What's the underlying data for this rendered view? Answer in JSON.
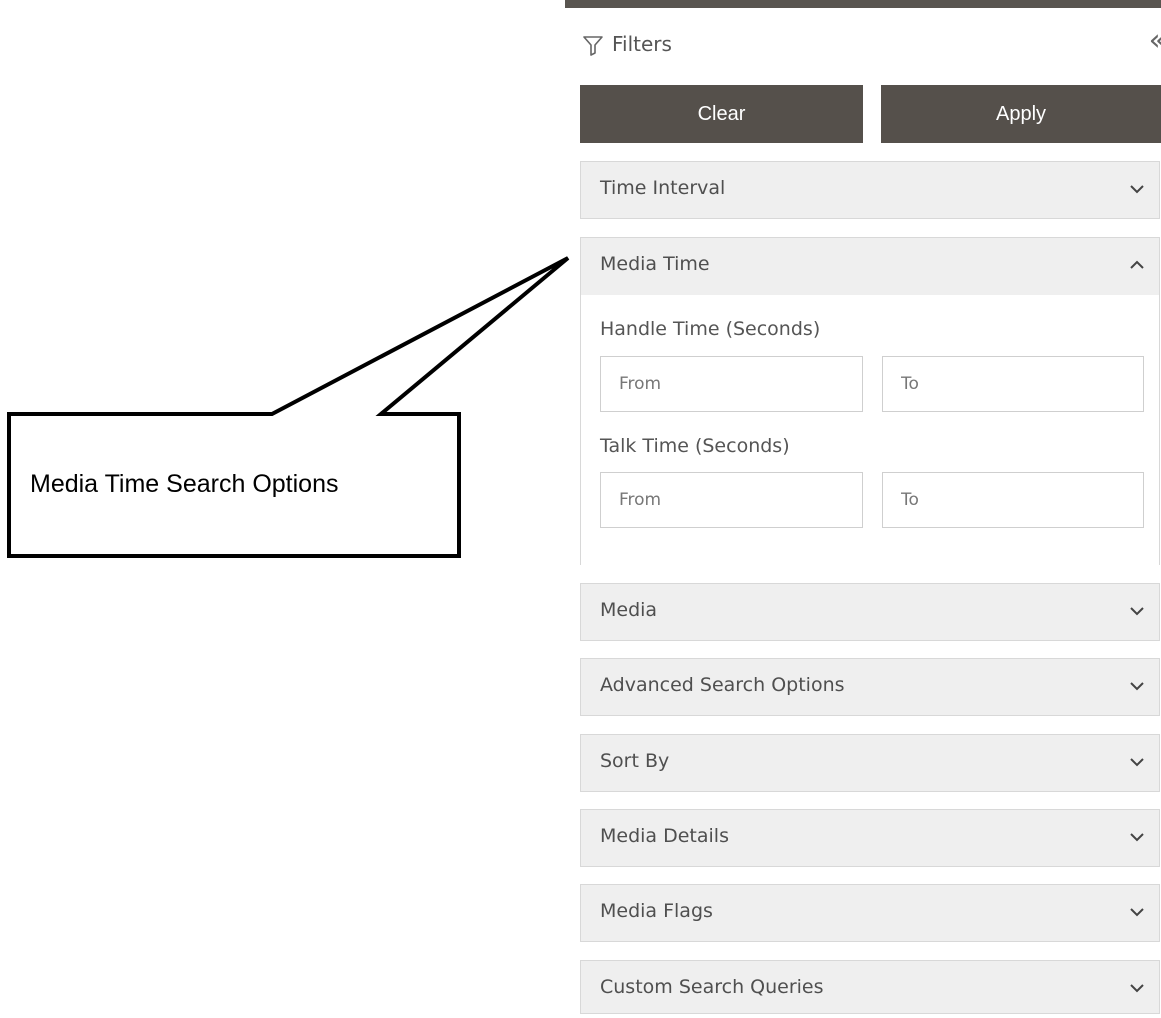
{
  "filters": {
    "title": "Filters",
    "clear_label": "Clear",
    "apply_label": "Apply"
  },
  "sections": {
    "time_interval": "Time Interval",
    "media_time": "Media Time",
    "media": "Media",
    "advanced_search_options": "Advanced Search Options",
    "sort_by": "Sort By",
    "media_details": "Media Details",
    "media_flags": "Media Flags",
    "custom_search_queries": "Custom Search Queries"
  },
  "media_time": {
    "handle_time_label": "Handle Time (Seconds)",
    "talk_time_label": "Talk Time (Seconds)",
    "from_placeholder": "From",
    "to_placeholder": "To"
  },
  "callout": {
    "text": "Media Time Search Options"
  },
  "colors": {
    "button_bg": "#55504b",
    "section_bg": "#efefef",
    "topbar": "#595550"
  },
  "icons": {
    "filter": "funnel-icon",
    "collapse": "double-chevron-left-icon",
    "expand": "chevron-down-icon",
    "collapse_section": "chevron-up-icon"
  }
}
